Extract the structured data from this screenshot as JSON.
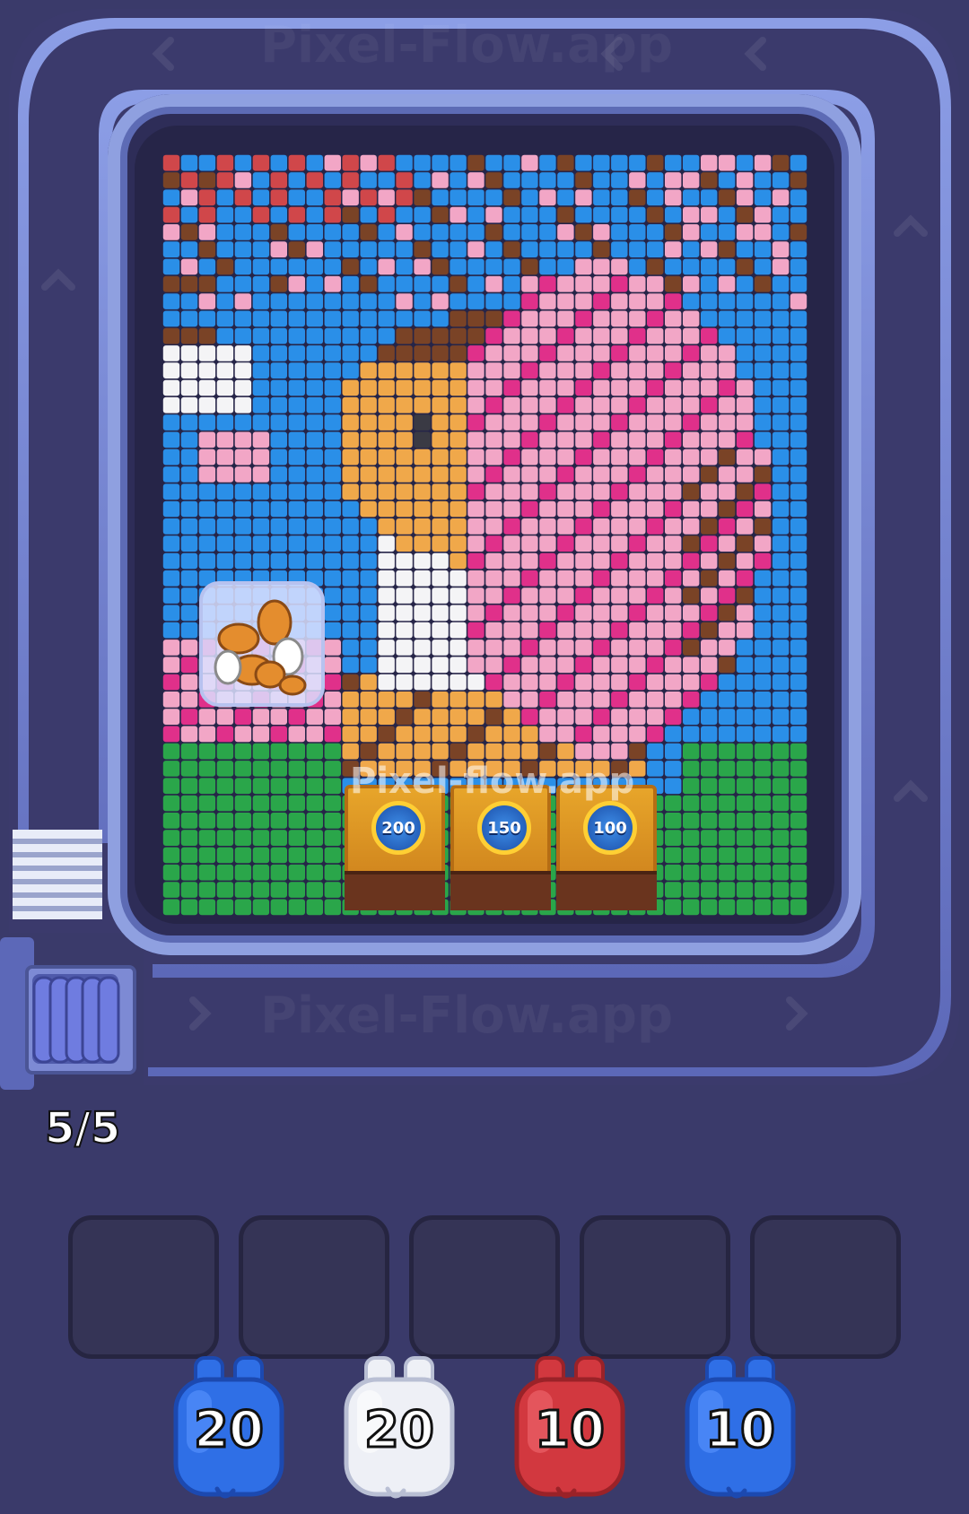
{
  "game": {
    "watermark_text": "Pixel-Flow.app",
    "board_watermark": "Pixel-flow.app",
    "stack_counter": "5/5"
  },
  "bins": [
    {
      "value": "200"
    },
    {
      "value": "150"
    },
    {
      "value": "100"
    }
  ],
  "shooters": [
    {
      "count": "20",
      "color": "#2f6fe6",
      "dark": "#1c49b0",
      "light": "#5a95ff"
    },
    {
      "count": "20",
      "color": "#eef0f6",
      "dark": "#b9bfd4",
      "light": "#ffffff"
    },
    {
      "count": "10",
      "color": "#d2383f",
      "dark": "#9a2228",
      "light": "#f06970"
    },
    {
      "count": "10",
      "color": "#2f6fe6",
      "dark": "#1c49b0",
      "light": "#5a95ff"
    }
  ],
  "colors": {
    "sky": "#2a8fe8",
    "pink": "#f2a6c6",
    "hot_pink": "#e0308a",
    "brown": "#7a4326",
    "tan": "#f0a84a",
    "white": "#f4f4f6",
    "dark": "#3a3a44",
    "green": "#2aa64a",
    "red": "#d0474a"
  }
}
